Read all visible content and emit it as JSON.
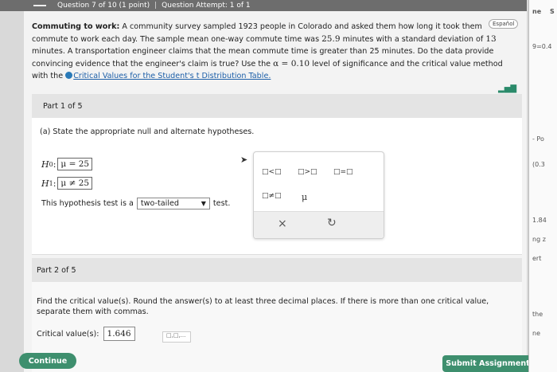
{
  "header": {
    "question_num": "Question 7 of 10 (1 point)",
    "separator": "|",
    "attempt": "Question Attempt: 1 of 1"
  },
  "question": {
    "title": "Commuting to work:",
    "line1": "A community survey sampled 1923 people in Colorado and asked them how long it took them",
    "line2_a": "commute to work each day. The sample mean one-way commute time was ",
    "mean": "25.9",
    "line2_b": " minutes with a standard deviation of ",
    "sd": "13",
    "line3": "minutes. A transportation engineer claims that the mean commute time is greater than 25 minutes. Do the data provide",
    "line4_a": "convincing evidence that the engineer's claim is true? Use the ",
    "alpha": "α = 0.10",
    "line4_b": " level of significance and the critical value method",
    "line5": "with the",
    "link": "Critical Values for the Student's t Distribution Table.",
    "espanol": "Español"
  },
  "part1": {
    "label": "Part 1 of 5",
    "prompt": "(a) State the appropriate null and alternate hypotheses.",
    "h0_label": "H",
    "h0_sub": "0",
    "h0_value": "μ = 25",
    "h1_label": "H",
    "h1_sub": "1",
    "h1_value": "μ ≠ 25",
    "tail_prefix": "This hypothesis test is a",
    "tail_selected": "two-tailed",
    "tail_suffix": "test."
  },
  "palette": {
    "lt": "□<□",
    "gt": "□>□",
    "eq": "□=□",
    "ne": "□≠□",
    "mu": "μ",
    "clear": "×",
    "undo": "↻"
  },
  "part2": {
    "label": "Part 2 of 5",
    "prompt": "Find the critical value(s). Round the answer(s) to at least three decimal places. If there is more than one critical value, separate them with commas.",
    "cv_label": "Critical value(s):",
    "cv_value": "1.646",
    "mini_palette": "□,□,..."
  },
  "buttons": {
    "continue": "Continue",
    "submit": "Submit Assignment"
  },
  "side": {
    "t1": "ne",
    "t2": "S",
    "t3": "9=0.4",
    "t4": "- Po",
    "t5": "(0.3",
    "t6": "1.84",
    "t7": "ng z",
    "t8": "ert",
    "t9": "the",
    "t10": "ne"
  }
}
